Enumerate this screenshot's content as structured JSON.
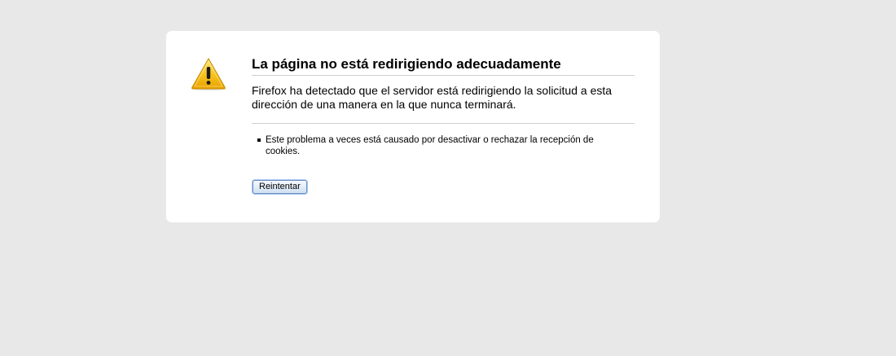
{
  "error": {
    "title": "La página no está redirigiendo adecuadamente",
    "short_desc": "Firefox ha detectado que el servidor está redirigiendo la solicitud a esta dirección de una manera en la que nunca terminará.",
    "long_desc_items": [
      "Este problema a veces está causado por desactivar o rechazar la recepción de cookies."
    ],
    "retry_label": "Reintentar",
    "icon": "warning-icon"
  },
  "colors": {
    "background": "#e8e8e8",
    "box": "#ffffff",
    "warning_yellow": "#f7c21c"
  }
}
